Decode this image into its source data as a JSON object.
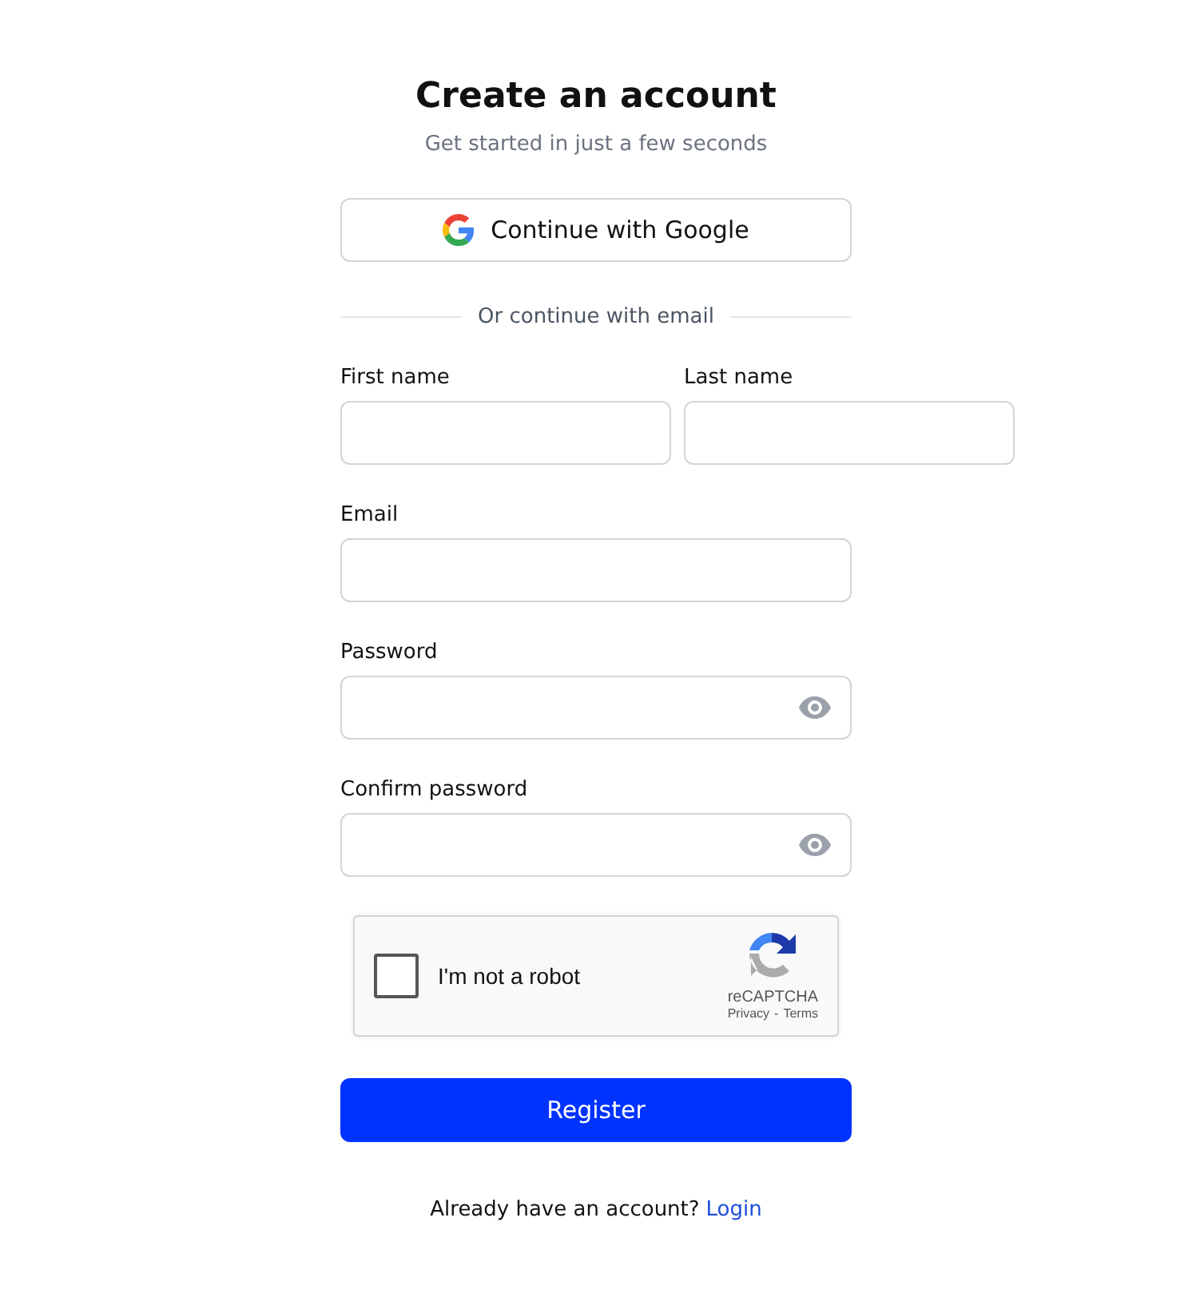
{
  "title": "Create an account",
  "subtitle": "Get started in just a few seconds",
  "google_button": {
    "label": "Continue with Google"
  },
  "divider": {
    "label": "Or continue with email"
  },
  "field_rows": [
    {
      "fields": [
        {
          "label": "First name",
          "kind": "text"
        },
        {
          "label": "Last name",
          "kind": "text"
        }
      ]
    },
    {
      "fields": [
        {
          "label": "Email",
          "kind": "text"
        }
      ]
    },
    {
      "fields": [
        {
          "label": "Password",
          "kind": "password"
        }
      ]
    },
    {
      "fields": [
        {
          "label": "Confirm password",
          "kind": "password"
        }
      ]
    }
  ],
  "captcha": {
    "label": "I'm not a robot",
    "checked": false,
    "brand": "reCAPTCHA",
    "privacy": "Privacy",
    "separator": "-",
    "terms": "Terms"
  },
  "register_button": {
    "label": "Register"
  },
  "footer": {
    "text": "Already have an account?",
    "link": "Login"
  }
}
